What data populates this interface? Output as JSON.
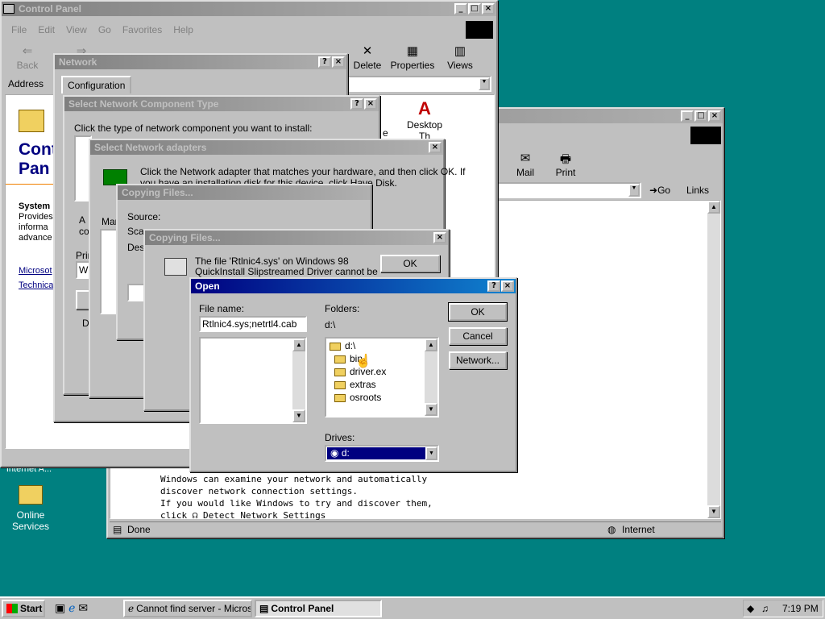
{
  "control_panel": {
    "title": "Control Panel",
    "menu": [
      "File",
      "Edit",
      "View",
      "Go",
      "Favorites",
      "Help"
    ],
    "toolbar": {
      "back": "Back",
      "forward": "Forward",
      "delete": "Delete",
      "properties": "Properties",
      "views": "Views"
    },
    "address_label": "Address",
    "heading_line1": "Cont",
    "heading_line2": "Pan",
    "side_title": "System",
    "side_text": [
      "Provides",
      "informa",
      "advance"
    ],
    "links": [
      "Microsot",
      "Technica"
    ],
    "icon_desktop": "Desktop",
    "icon_desktop2": "Th",
    "icon_e": "e"
  },
  "browser": {
    "toolbar": {
      "mail": "Mail",
      "print": "Print"
    },
    "go": "Go",
    "links": "Links",
    "body_lines": [
      "Windows can examine your network and automatically",
      "discover network connection settings.",
      "If you would like Windows to try and discover them,"
    ],
    "click": "click",
    "detect": "Detect Network Settings",
    "status_left": "Done",
    "status_zone": "Internet"
  },
  "network": {
    "title": "Network",
    "tab": "Configuration"
  },
  "select_type": {
    "title": "Select Network Component Type",
    "prompt": "Click the type of network component you want to install:",
    "a": "A",
    "co": "co",
    "pri": "Prin",
    "wi": "Wi",
    "d": "D"
  },
  "select_adapters": {
    "title": "Select Network adapters",
    "text1": "Click the Network adapter that matches your hardware, and then click OK. If",
    "text2": "you have an installation disk for this device, click Have Disk.",
    "man": "Mar"
  },
  "copying1": {
    "title": "Copying Files...",
    "source": "Source:",
    "scan": "Sca",
    "dest": "Des"
  },
  "copying2": {
    "title": "Copying Files...",
    "msg1": "The file 'Rtlnic4.sys' on Windows 98",
    "msg2": "QuickInstall Slipstreamed Driver cannot be",
    "ok": "OK"
  },
  "open": {
    "title": "Open",
    "file_name_label": "File name:",
    "file_name": "Rtlnic4.sys;netrtl4.cab",
    "folders_label": "Folders:",
    "current_path": "d:\\",
    "folders": [
      "d:\\",
      "bin",
      "driver.ex",
      "extras",
      "osroots"
    ],
    "drives_label": "Drives:",
    "drive": "d:",
    "ok": "OK",
    "cancel": "Cancel",
    "network": "Network..."
  },
  "desktop": {
    "icon1": "Internet A...",
    "icon2_line1": "Online",
    "icon2_line2": "Services"
  },
  "taskbar": {
    "start": "Start",
    "task1": "Cannot find server - Micros...",
    "task2": "Control Panel",
    "clock": "7:19 PM"
  },
  "colors": {
    "desktop": "#008080",
    "titlebar": "#000080",
    "face": "#c0c0c0"
  }
}
